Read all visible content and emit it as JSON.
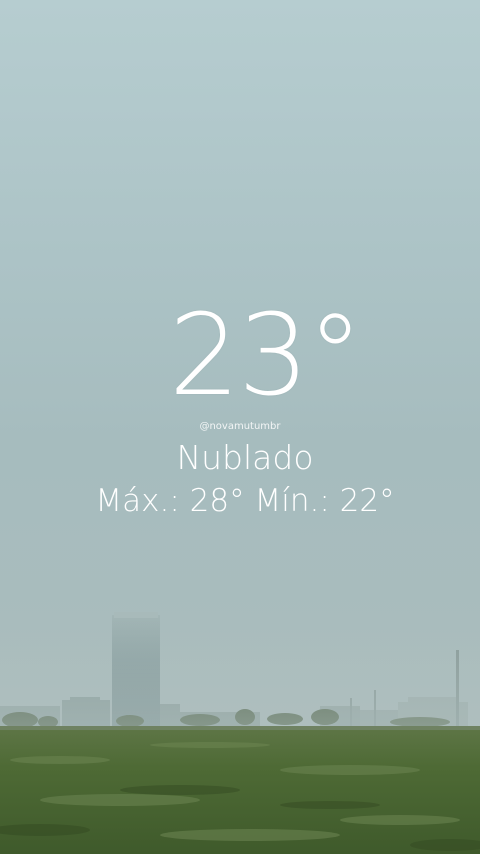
{
  "weather": {
    "temperature": "23°",
    "handle": "@novamutumbr",
    "condition": "Nublado",
    "max_label": "Máx.: 28°",
    "min_label": "Mín.: 22°"
  },
  "colors": {
    "sky": "#aec4c6",
    "grass": "#4f6b35",
    "text": "#ffffff"
  }
}
